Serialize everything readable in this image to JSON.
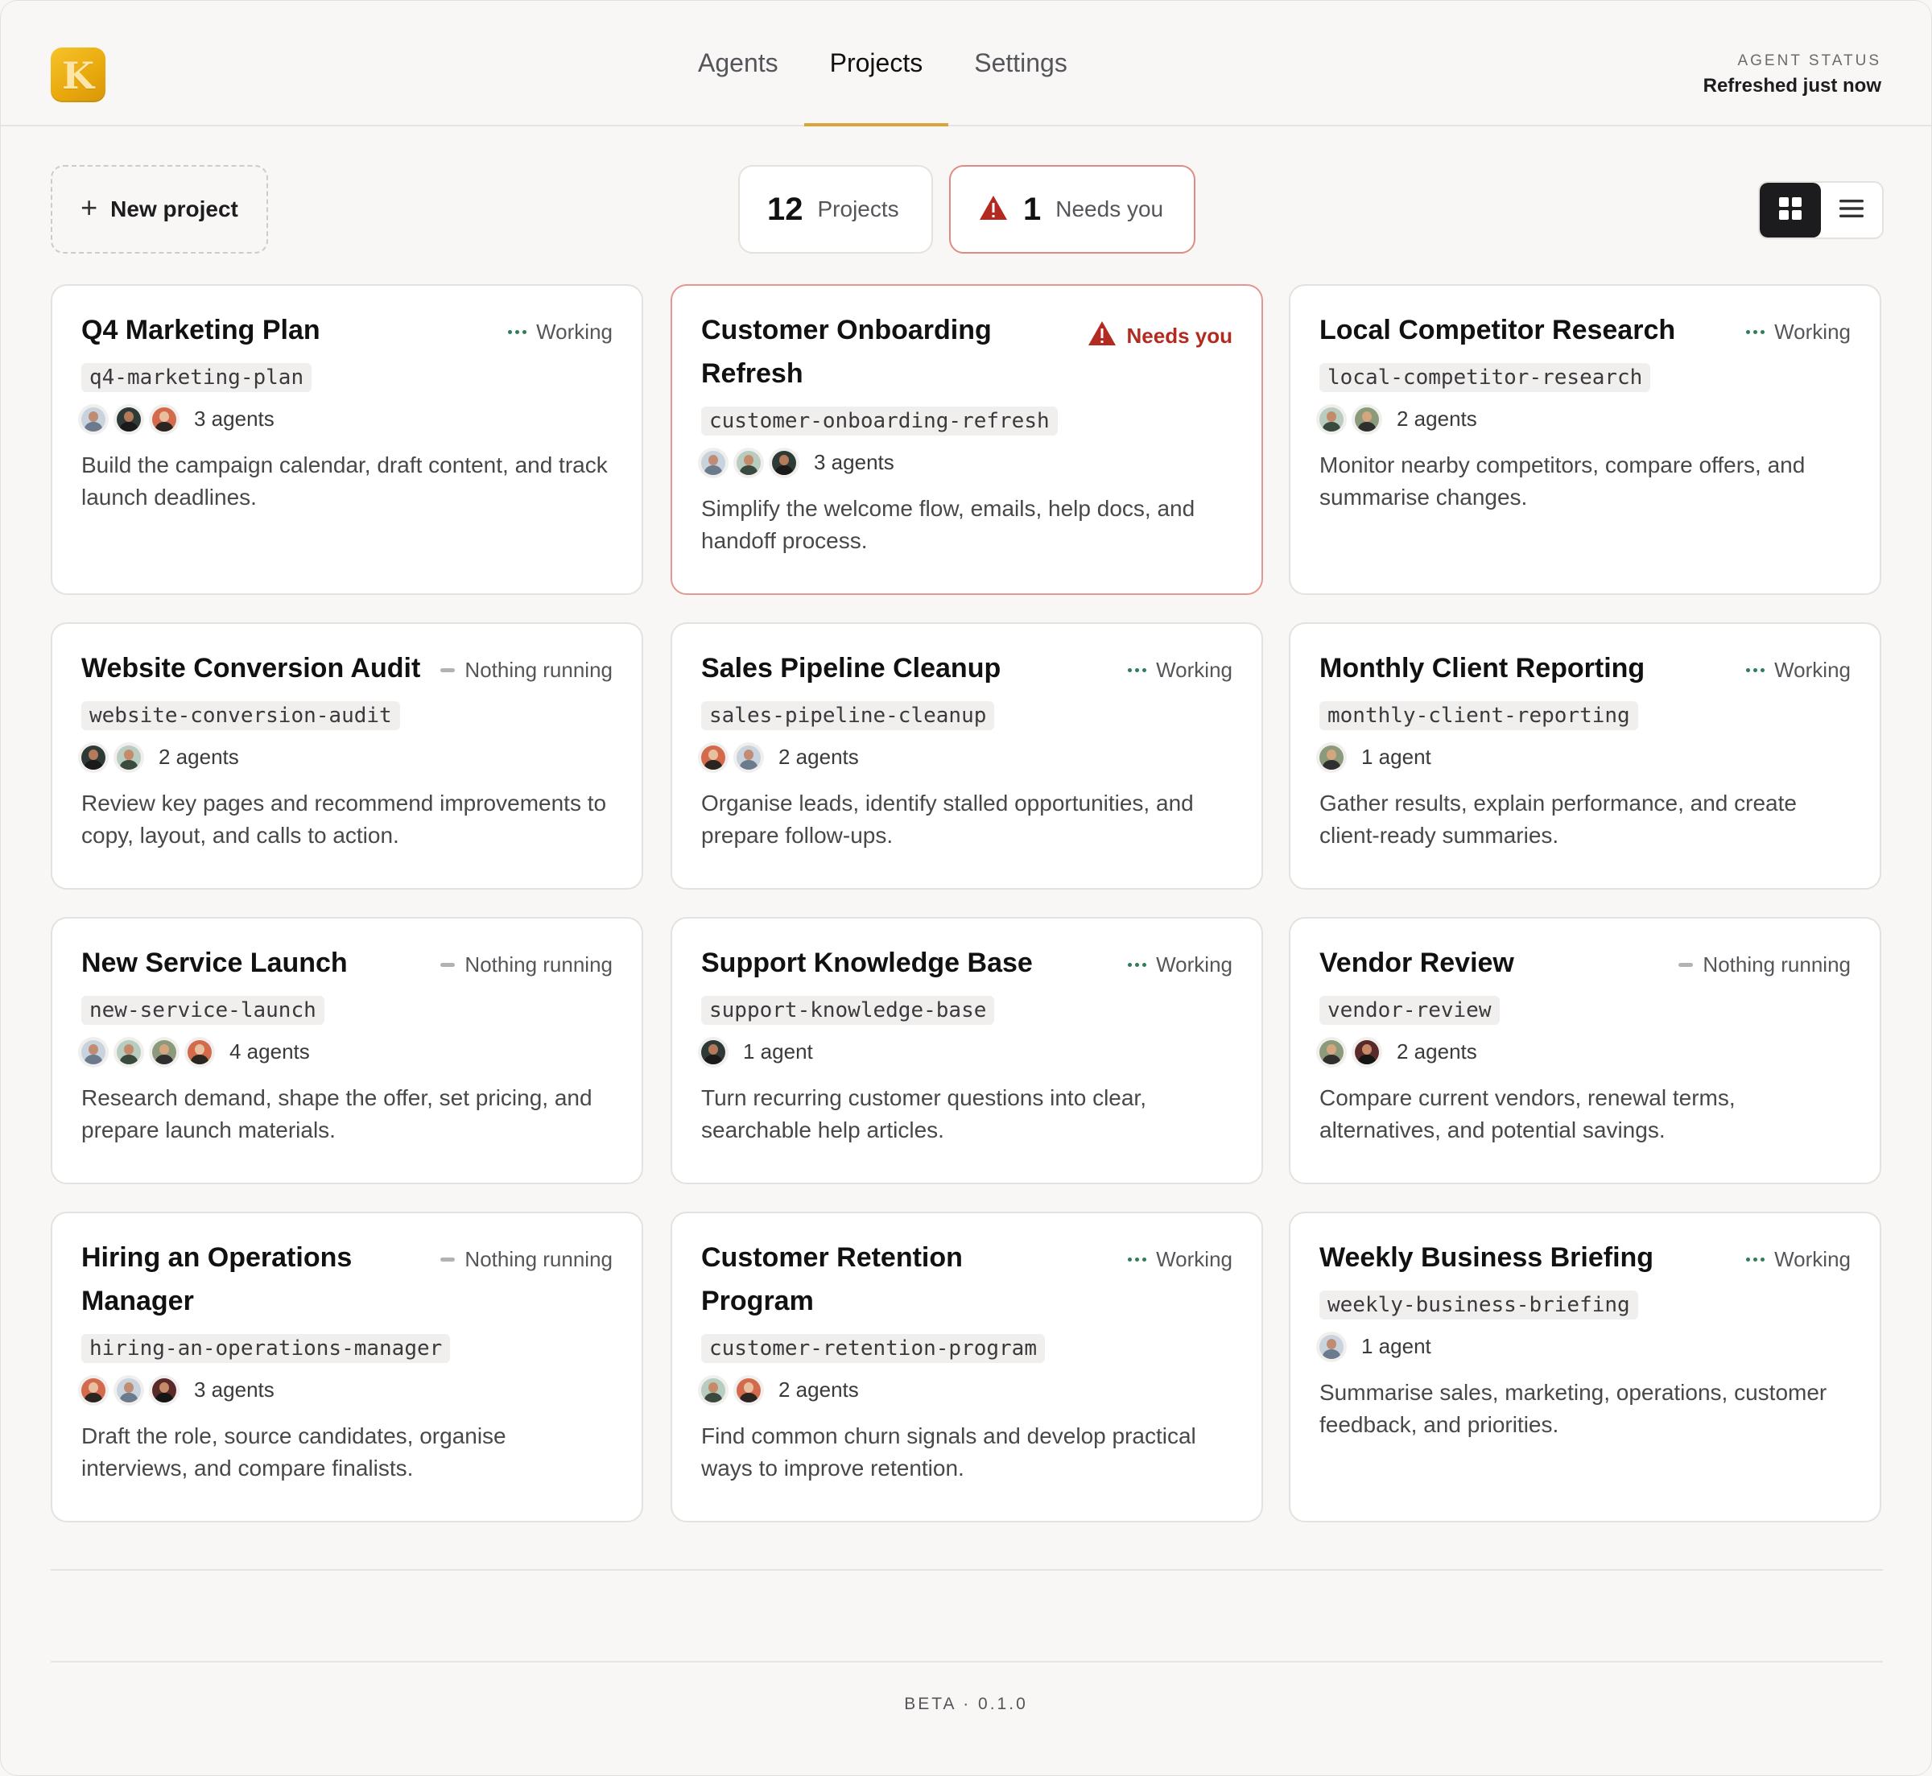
{
  "header": {
    "logo_letter": "K",
    "tabs": [
      {
        "label": "Agents",
        "active": false
      },
      {
        "label": "Projects",
        "active": true
      },
      {
        "label": "Settings",
        "active": false
      }
    ],
    "agent_status_label": "AGENT STATUS",
    "agent_status_value": "Refreshed just now"
  },
  "toolbar": {
    "new_project_icon": "plus-icon",
    "new_project_label": "New project",
    "projects_count": "12",
    "projects_label": "Projects",
    "needs_icon": "warning-triangle-icon",
    "needs_count": "1",
    "needs_label": "Needs you",
    "view_modes": [
      {
        "icon": "grid-view-icon",
        "active": true
      },
      {
        "icon": "list-view-icon",
        "active": false
      }
    ]
  },
  "colors": {
    "accent": "#d9a53a",
    "working": "#2f7d5a",
    "alert": "#b22a20",
    "alert_border": "#e4968f"
  },
  "projects": [
    {
      "title": "Q4 Marketing Plan",
      "status": "Working",
      "status_type": "working",
      "slug": "q4-marketing-plan",
      "avatars": [
        "a1",
        "a2",
        "a3"
      ],
      "agents": "3 agents",
      "desc": "Build the campaign calendar, draft content, and track launch deadlines."
    },
    {
      "title": "Customer Onboarding Refresh",
      "status": "Needs you",
      "status_type": "needs",
      "slug": "customer-onboarding-refresh",
      "avatars": [
        "a1",
        "a4",
        "a2"
      ],
      "agents": "3 agents",
      "desc": "Simplify the welcome flow, emails, help docs, and handoff process."
    },
    {
      "title": "Local Competitor Research",
      "status": "Working",
      "status_type": "working",
      "slug": "local-competitor-research",
      "avatars": [
        "a4",
        "a5"
      ],
      "agents": "2 agents",
      "desc": "Monitor nearby competitors, compare offers, and summarise changes."
    },
    {
      "title": "Website Conversion Audit",
      "status": "Nothing running",
      "status_type": "idle",
      "slug": "website-conversion-audit",
      "avatars": [
        "a2",
        "a4"
      ],
      "agents": "2 agents",
      "desc": "Review key pages and recommend improvements to copy, layout, and calls to action."
    },
    {
      "title": "Sales Pipeline Cleanup",
      "status": "Working",
      "status_type": "working",
      "slug": "sales-pipeline-cleanup",
      "avatars": [
        "a3",
        "a1"
      ],
      "agents": "2 agents",
      "desc": "Organise leads, identify stalled opportunities, and prepare follow-ups."
    },
    {
      "title": "Monthly Client Reporting",
      "status": "Working",
      "status_type": "working",
      "slug": "monthly-client-reporting",
      "avatars": [
        "a5"
      ],
      "agents": "1 agent",
      "desc": "Gather results, explain performance, and create client-ready summaries."
    },
    {
      "title": "New Service Launch",
      "status": "Nothing running",
      "status_type": "idle",
      "slug": "new-service-launch",
      "avatars": [
        "a1",
        "a4",
        "a5",
        "a3"
      ],
      "agents": "4 agents",
      "desc": "Research demand, shape the offer, set pricing, and prepare launch materials."
    },
    {
      "title": "Support Knowledge Base",
      "status": "Working",
      "status_type": "working",
      "slug": "support-knowledge-base",
      "avatars": [
        "a2"
      ],
      "agents": "1 agent",
      "desc": "Turn recurring customer questions into clear, searchable help articles."
    },
    {
      "title": "Vendor Review",
      "status": "Nothing running",
      "status_type": "idle",
      "slug": "vendor-review",
      "avatars": [
        "a5",
        "a6"
      ],
      "agents": "2 agents",
      "desc": "Compare current vendors, renewal terms, alternatives, and potential savings."
    },
    {
      "title": "Hiring an Operations Manager",
      "status": "Nothing running",
      "status_type": "idle",
      "slug": "hiring-an-operations-manager",
      "avatars": [
        "a3",
        "a1",
        "a6"
      ],
      "agents": "3 agents",
      "desc": "Draft the role, source candidates, organise interviews, and compare finalists."
    },
    {
      "title": "Customer Retention Program",
      "status": "Working",
      "status_type": "working",
      "slug": "customer-retention-program",
      "avatars": [
        "a4",
        "a3"
      ],
      "agents": "2 agents",
      "desc": "Find common churn signals and develop practical ways to improve retention."
    },
    {
      "title": "Weekly Business Briefing",
      "status": "Working",
      "status_type": "working",
      "slug": "weekly-business-briefing",
      "avatars": [
        "a1"
      ],
      "agents": "1 agent",
      "desc": "Summarise sales, marketing, operations, customer feedback, and priorities."
    }
  ],
  "footer": {
    "version": "BETA · 0.1.0"
  }
}
